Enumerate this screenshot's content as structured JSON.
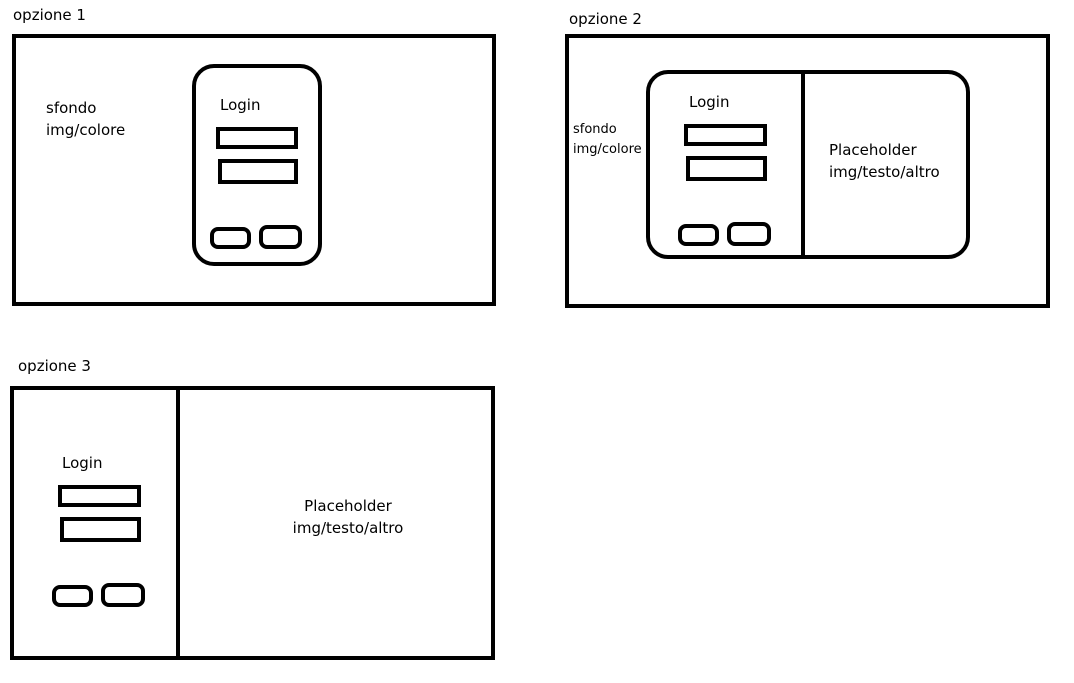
{
  "option1": {
    "caption": "opzione 1",
    "background_line1": "sfondo",
    "background_line2": "img/colore",
    "login_title": "Login"
  },
  "option2": {
    "caption": "opzione 2",
    "background_line1": "sfondo",
    "background_line2": "img/colore",
    "login_title": "Login",
    "placeholder_line1": "Placeholder",
    "placeholder_line2": "img/testo/altro"
  },
  "option3": {
    "caption": "opzione 3",
    "login_title": "Login",
    "placeholder_line1": "Placeholder",
    "placeholder_line2": "img/testo/altro"
  }
}
